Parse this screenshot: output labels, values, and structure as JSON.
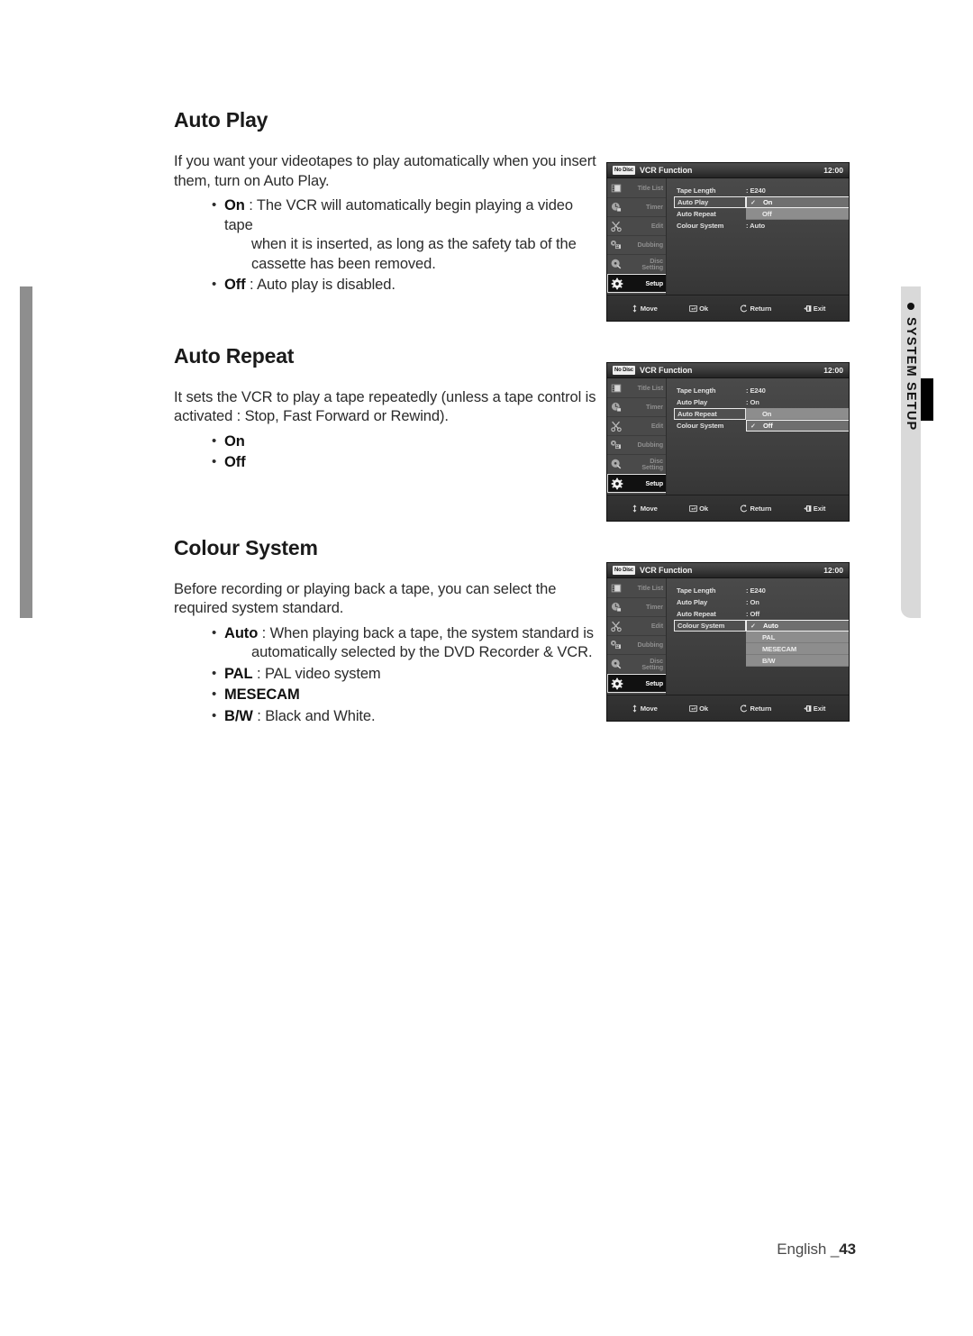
{
  "document": {
    "footer_language": "English _",
    "footer_page": "43"
  },
  "side_tab": {
    "label": "SYSTEM SETUP",
    "bullet": "dot-icon"
  },
  "sections": [
    {
      "title": "Auto Play",
      "paragraphs": [
        "If you want your videotapes to play automatically when you insert",
        "them, turn on Auto Play."
      ],
      "bullets": [
        {
          "term": "On",
          "sep": " : ",
          "text": "The VCR will automatically begin playing a video tape",
          "cont": "when it is inserted, as long as the safety tab of the cassette has been removed."
        },
        {
          "term": "Off",
          "sep": " : ",
          "text": "Auto play is disabled.",
          "cont": ""
        }
      ]
    },
    {
      "title": "Auto Repeat",
      "paragraphs": [
        "It sets the VCR to play a tape repeatedly (unless a tape control is",
        "activated : Stop, Fast Forward or Rewind)."
      ],
      "bullets": [
        {
          "term": "On",
          "sep": "",
          "text": "",
          "cont": ""
        },
        {
          "term": "Off",
          "sep": "",
          "text": "",
          "cont": ""
        }
      ]
    },
    {
      "title": "Colour System",
      "paragraphs": [
        "Before recording or playing back a tape, you can select the required",
        "system standard."
      ],
      "bullets": [
        {
          "term": "Auto",
          "sep": " : ",
          "text": "When playing back a tape, the system standard is",
          "cont": "automatically selected by the DVD Recorder & VCR."
        },
        {
          "term": "PAL",
          "sep": " : ",
          "text": "PAL video system",
          "cont": ""
        },
        {
          "term": "MESECAM",
          "sep": "",
          "text": "",
          "cont": ""
        },
        {
          "term": "B/W",
          "sep": " : ",
          "text": "Black and White.",
          "cont": ""
        }
      ]
    }
  ],
  "osd_common": {
    "badge": "No Disc",
    "title": "VCR Function",
    "clock": "12:00",
    "sidebar": [
      {
        "label": "Title List",
        "icon": "film-strip-icon",
        "active": false
      },
      {
        "label": "Timer",
        "icon": "clock-icon",
        "active": false
      },
      {
        "label": "Edit",
        "icon": "scissors-icon",
        "active": false
      },
      {
        "label": "Dubbing",
        "icon": "dubbing-icon",
        "active": false
      },
      {
        "label": "Disc\nSetting",
        "icon": "disc-icon",
        "active": false
      },
      {
        "label": "Setup",
        "icon": "gear-icon",
        "active": true
      }
    ],
    "footer": [
      {
        "label": "Move",
        "icon": "up-down-arrow-icon"
      },
      {
        "label": "Ok",
        "icon": "enter-key-icon"
      },
      {
        "label": "Return",
        "icon": "return-arrow-icon"
      },
      {
        "label": "Exit",
        "icon": "exit-icon"
      }
    ]
  },
  "osd_screens": [
    {
      "id": "auto-play",
      "rows": [
        {
          "label": "Tape Length",
          "value": ": E240",
          "selected": false
        },
        {
          "label": "Auto Play",
          "value": "",
          "selected": true
        },
        {
          "label": "Auto Repeat",
          "value": "",
          "selected": false
        },
        {
          "label": "Colour System",
          "value": ": Auto",
          "selected": false
        }
      ],
      "dropdown": {
        "top_row": 1,
        "items": [
          {
            "label": "On",
            "checked": true,
            "current": true
          },
          {
            "label": "Off",
            "checked": false,
            "current": false
          }
        ]
      }
    },
    {
      "id": "auto-repeat",
      "rows": [
        {
          "label": "Tape Length",
          "value": ": E240",
          "selected": false
        },
        {
          "label": "Auto Play",
          "value": ": On",
          "selected": false
        },
        {
          "label": "Auto Repeat",
          "value": "",
          "selected": true
        },
        {
          "label": "Colour System",
          "value": "",
          "selected": false
        }
      ],
      "dropdown": {
        "top_row": 2,
        "items": [
          {
            "label": "On",
            "checked": false,
            "current": false
          },
          {
            "label": "Off",
            "checked": true,
            "current": true
          }
        ]
      }
    },
    {
      "id": "colour-system",
      "rows": [
        {
          "label": "Tape Length",
          "value": ": E240",
          "selected": false
        },
        {
          "label": "Auto Play",
          "value": ": On",
          "selected": false
        },
        {
          "label": "Auto Repeat",
          "value": ": Off",
          "selected": false
        },
        {
          "label": "Colour System",
          "value": "",
          "selected": true
        }
      ],
      "dropdown": {
        "top_row": 3,
        "items": [
          {
            "label": "Auto",
            "checked": true,
            "current": true
          },
          {
            "label": "PAL",
            "checked": false,
            "current": false
          },
          {
            "label": "MESECAM",
            "checked": false,
            "current": false
          },
          {
            "label": "B/W",
            "checked": false,
            "current": false
          }
        ]
      }
    }
  ],
  "colors": {
    "osd_bg": "#3f3f3f",
    "osd_sidebar": "#4a4a4a",
    "dropdown_bg": "#8d8d8d",
    "side_tab": "#d9d9d9",
    "side_tab_strip": "#8e8e8e"
  }
}
